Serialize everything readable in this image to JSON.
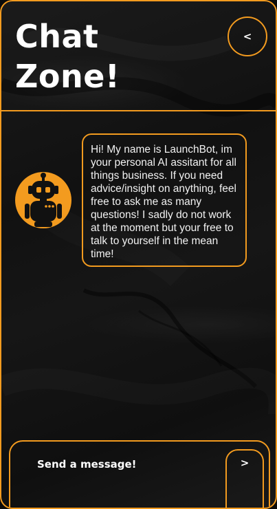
{
  "header": {
    "title": "Chat Zone!",
    "back_label": "<"
  },
  "colors": {
    "accent": "#f39b1f",
    "background": "#141414",
    "text": "#ffffff"
  },
  "chat": {
    "messages": [
      {
        "sender_avatar": "robot-icon",
        "text": "Hi! My name is LaunchBot, im your personal AI assitant for all things business. If you need advice/insight on anything, feel free to ask me as many questions! I sadly do not work at the moment but your free to talk to yourself in the mean time!"
      }
    ]
  },
  "composer": {
    "placeholder": "Send a message!",
    "send_label": ">"
  }
}
